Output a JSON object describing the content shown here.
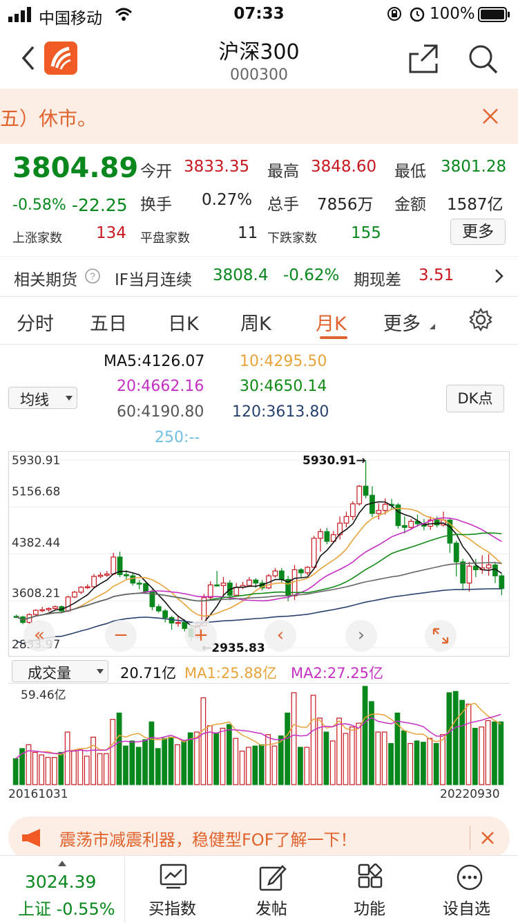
{
  "status_bar": {
    "carrier": "中国移动",
    "time": "07:33",
    "battery_pct": "100%"
  },
  "header": {
    "title": "沪深300",
    "code": "000300"
  },
  "notice": {
    "text": "五）休市。"
  },
  "quote": {
    "price": "3804.89",
    "change_pct": "-0.58%",
    "change": "-22.25",
    "open_label": "今开",
    "open": "3833.35",
    "high_label": "最高",
    "high": "3848.60",
    "low_label": "最低",
    "low": "3801.28",
    "turnover_label": "换手",
    "turnover": "0.27%",
    "volume_label": "总手",
    "volume": "7856万",
    "amount_label": "金额",
    "amount": "1587亿",
    "up_label": "上涨家数",
    "up": "134",
    "flat_label": "平盘家数",
    "flat": "11",
    "down_label": "下跌家数",
    "down": "155",
    "more_label": "更多"
  },
  "futures": {
    "label": "相关期货",
    "name": "IF当月连续",
    "price": "3808.4",
    "change_pct": "-0.62%",
    "basis_label": "期现差",
    "basis": "3.51"
  },
  "tabs": [
    "分时",
    "五日",
    "日K",
    "周K",
    "月K",
    "更多"
  ],
  "active_tab": "月K",
  "ma": {
    "selector": "均线",
    "ma5": "MA5:4126.07",
    "ma10": "10:4295.50",
    "ma20": "20:4662.16",
    "ma30": "30:4650.14",
    "ma60": "60:4190.80",
    "ma120": "120:3613.80",
    "ma250": "250:--",
    "dk_button": "DK点"
  },
  "colors": {
    "up": "#c8171e",
    "down": "#07871c",
    "accent": "#e0632e",
    "ma5": "#111111",
    "ma10": "#e8a33a",
    "ma20": "#c62fc4",
    "ma30": "#0f8a14",
    "ma60": "#666666",
    "ma120": "#28416e"
  },
  "chart_labels": {
    "y_ticks": [
      "5930.91",
      "5156.68",
      "4382.44",
      "3608.21",
      "2833.97"
    ],
    "high_mark": "5930.91→",
    "low_mark": "←2935.83"
  },
  "volume": {
    "selector": "成交量",
    "value": "20.71亿",
    "ma1": "MA1:25.88亿",
    "ma2": "MA2:27.25亿",
    "max_label": "59.46亿",
    "start_date": "20161031",
    "end_date": "20220930"
  },
  "ad": {
    "text": "震荡市减震利器，稳健型FOF了解一下！"
  },
  "bottom_bar": {
    "index_price": "3024.39",
    "index_label": "上证 -0.55%",
    "items": [
      "买指数",
      "发帖",
      "功能",
      "设自选"
    ]
  },
  "chart_data": {
    "type": "candlestick",
    "title": "沪深300 月K",
    "x_range": [
      "20161031",
      "20220930"
    ],
    "ylim": [
      2833.97,
      5930.91
    ],
    "candles": [
      [
        3350,
        3340,
        3380,
        3320
      ],
      [
        3340,
        3250,
        3360,
        3220
      ],
      [
        3250,
        3380,
        3400,
        3230
      ],
      [
        3380,
        3450,
        3470,
        3360
      ],
      [
        3450,
        3460,
        3510,
        3420
      ],
      [
        3460,
        3480,
        3500,
        3430
      ],
      [
        3480,
        3510,
        3530,
        3460
      ],
      [
        3510,
        3440,
        3530,
        3420
      ],
      [
        3440,
        3670,
        3690,
        3420
      ],
      [
        3670,
        3750,
        3770,
        3650
      ],
      [
        3750,
        3830,
        3850,
        3720
      ],
      [
        3830,
        3840,
        3880,
        3800
      ],
      [
        3840,
        4010,
        4050,
        3820
      ],
      [
        4010,
        4030,
        4080,
        3980
      ],
      [
        4030,
        4050,
        4100,
        4000
      ],
      [
        4050,
        4330,
        4400,
        4030
      ],
      [
        4330,
        4040,
        4420,
        4000
      ],
      [
        4040,
        4020,
        4110,
        3950
      ],
      [
        4020,
        3900,
        4060,
        3860
      ],
      [
        3900,
        3890,
        3950,
        3800
      ],
      [
        3890,
        3760,
        3930,
        3720
      ],
      [
        3760,
        3510,
        3800,
        3450
      ],
      [
        3510,
        3440,
        3550,
        3410
      ],
      [
        3440,
        3330,
        3470,
        3250
      ],
      [
        3330,
        3240,
        3360,
        3130
      ],
      [
        3240,
        3250,
        3350,
        3180
      ],
      [
        3250,
        3150,
        3300,
        3100
      ],
      [
        3150,
        3010,
        3200,
        2936
      ],
      [
        3010,
        3200,
        3260,
        2990
      ],
      [
        3200,
        3660,
        3720,
        3180
      ],
      [
        3660,
        3870,
        3930,
        3610
      ],
      [
        3870,
        3860,
        4100,
        3840
      ],
      [
        3860,
        3900,
        4000,
        3700
      ],
      [
        3900,
        3700,
        3950,
        3620
      ],
      [
        3700,
        3830,
        3900,
        3680
      ],
      [
        3830,
        3860,
        3920,
        3800
      ],
      [
        3860,
        3950,
        4000,
        3850
      ],
      [
        3950,
        3900,
        3980,
        3820
      ],
      [
        3900,
        3820,
        3950,
        3780
      ],
      [
        3820,
        4020,
        4050,
        3800
      ],
      [
        4020,
        4100,
        4150,
        3990
      ],
      [
        4100,
        3960,
        4150,
        3910
      ],
      [
        3960,
        3690,
        4020,
        3600
      ],
      [
        3690,
        4120,
        4200,
        3620
      ],
      [
        4120,
        4070,
        4150,
        4000
      ],
      [
        4070,
        4160,
        4180,
        4030
      ],
      [
        4160,
        4640,
        4680,
        4120
      ],
      [
        4640,
        4750,
        4800,
        4420
      ],
      [
        4750,
        4590,
        4810,
        4540
      ],
      [
        4590,
        4700,
        4760,
        4560
      ],
      [
        4700,
        4890,
        5000,
        4620
      ],
      [
        4890,
        5000,
        5080,
        4820
      ],
      [
        5000,
        5210,
        5250,
        4940
      ],
      [
        5210,
        5500,
        5520,
        5180
      ],
      [
        5500,
        5350,
        5930,
        5300
      ],
      [
        5350,
        5050,
        5500,
        4990
      ],
      [
        5050,
        5100,
        5220,
        4950
      ],
      [
        5100,
        5200,
        5300,
        5030
      ],
      [
        5200,
        5190,
        5290,
        5110
      ],
      [
        5190,
        4850,
        5220,
        4800
      ],
      [
        4850,
        4820,
        5000,
        4720
      ],
      [
        4820,
        4920,
        4960,
        4780
      ],
      [
        4920,
        4880,
        5030,
        4830
      ],
      [
        4880,
        4840,
        4960,
        4770
      ],
      [
        4840,
        4940,
        5000,
        4780
      ],
      [
        4940,
        4860,
        5000,
        4820
      ],
      [
        4860,
        4940,
        5080,
        4830
      ],
      [
        4940,
        4560,
        4980,
        4400
      ],
      [
        4560,
        4250,
        4600,
        4010
      ],
      [
        4250,
        3900,
        4300,
        3780
      ],
      [
        3900,
        4180,
        4250,
        3760
      ],
      [
        4180,
        4120,
        4300,
        4000
      ],
      [
        4120,
        4150,
        4360,
        4050
      ],
      [
        4150,
        4200,
        4380,
        4020
      ],
      [
        4200,
        4020,
        4250,
        3900
      ],
      [
        4020,
        3810,
        4050,
        3700
      ]
    ]
  }
}
